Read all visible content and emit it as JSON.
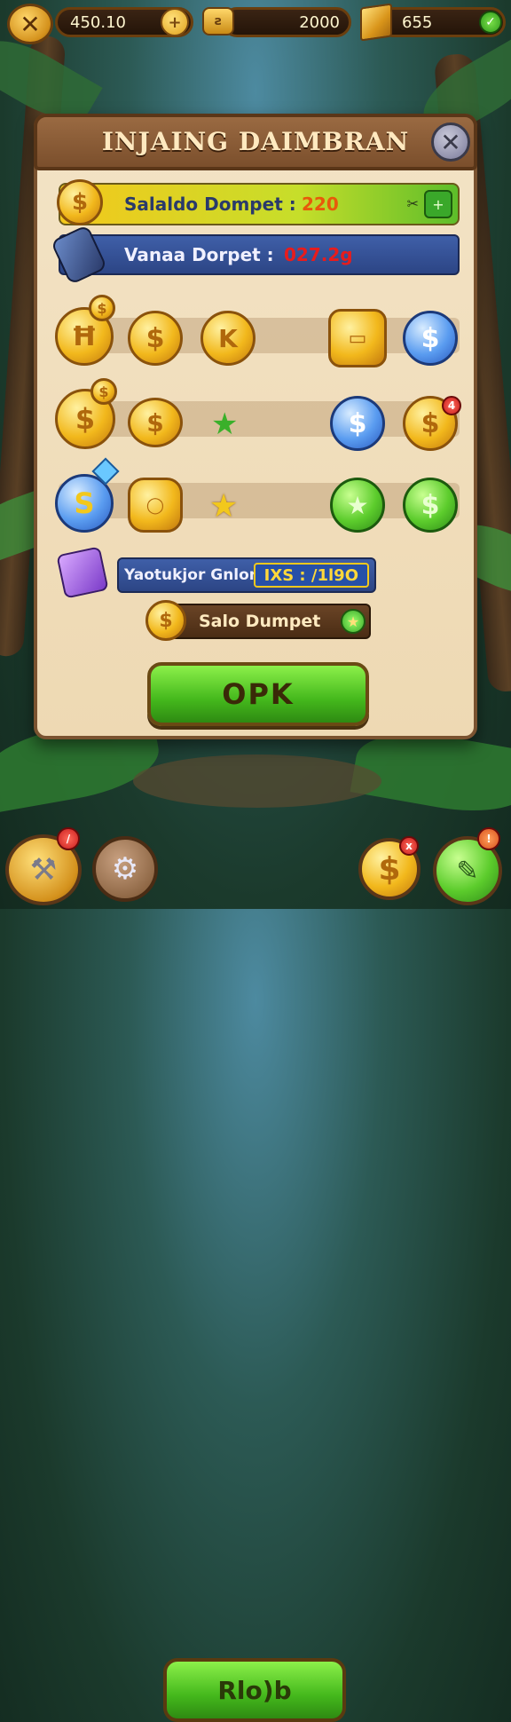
{
  "top_bar": {
    "coins_value": "450.10",
    "gold_value": "2000",
    "boxes_value": "655",
    "boxes_badge_icon": "check-icon"
  },
  "panel": {
    "title": "INJAING DAIMBRAN",
    "saldo_label": "Salaldo Dompet :",
    "saldo_value": "220",
    "variasi_label": "Vanaa Dorpet :",
    "variasi_value": "027.2g",
    "code_label": "Yaotukjor Gnlont:",
    "code_value": "IXS  :  /1l9O",
    "salo_label": "Salo Dumpet",
    "ok_label": "OPK",
    "coin_rows": [
      [
        "gold-h",
        "gold-s",
        "gold-k",
        "gold-bar",
        "blue-s"
      ],
      [
        "gold-s",
        "gold-s",
        "green-star",
        "blue-s",
        "gold-s"
      ],
      [
        "blue-s",
        "gold-ring",
        "gold-star",
        "green-star",
        "green-s"
      ]
    ]
  },
  "bottom_bar": {
    "center_label": "Rlo)b",
    "badge_left": "",
    "badge_right": "x"
  },
  "colors": {
    "accent_green": "#44b81c",
    "wood": "#7a5330",
    "parchment": "#f3e3c5",
    "gold": "#f2b81c",
    "blue_bar": "#2c4585"
  }
}
